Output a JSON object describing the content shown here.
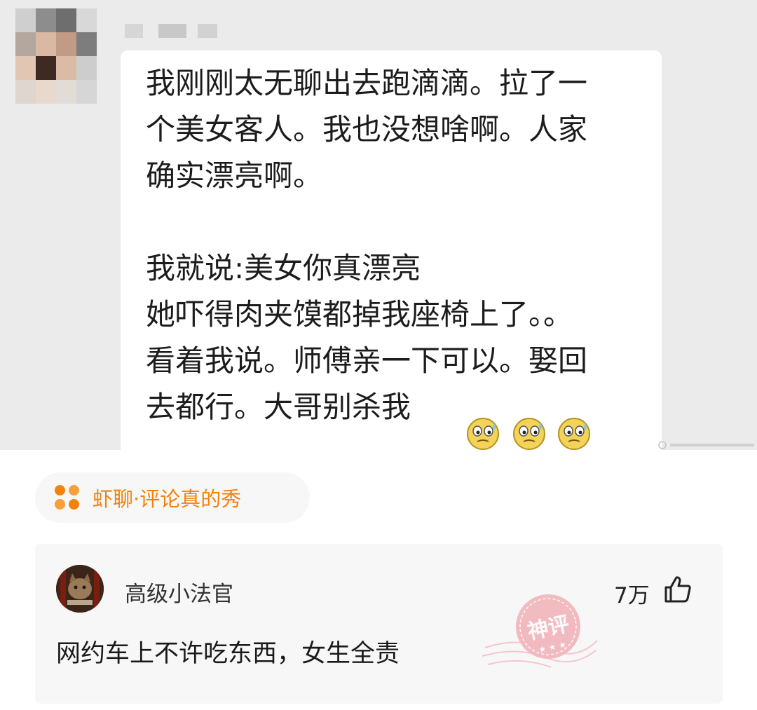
{
  "screenshot": {
    "chat_lines": [
      "我刚刚太无聊出去跑滴滴。拉了一",
      "个美女客人。我也没想啥啊。人家",
      "确实漂亮啊。",
      "",
      "我就说:美女你真漂亮",
      "她吓得肉夹馍都掉我座椅上了。。",
      "看着我说。师傅亲一下可以。娶回",
      "去都行。大哥别杀我"
    ],
    "emoji": [
      "sweat-face-icon",
      "sweat-face-icon",
      "sweat-face-icon"
    ]
  },
  "source": {
    "label": "虾聊·评论真的秀",
    "icon": "four-dots-icon",
    "color": "#f2820c"
  },
  "comment": {
    "username": "高级小法官",
    "likes": "7万",
    "like_icon": "thumbs-up-icon",
    "text": "网约车上不许吃东西，女生全责",
    "badge": "神评"
  }
}
